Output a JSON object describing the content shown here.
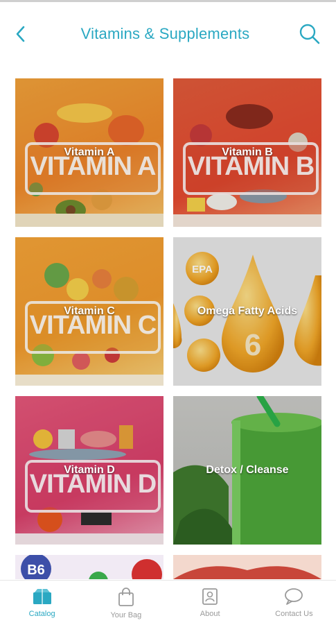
{
  "header": {
    "title": "Vitamins & Supplements"
  },
  "tiles": [
    {
      "label": "Vitamin A",
      "banner": "VITAMIN A"
    },
    {
      "label": "Vitamin B",
      "banner": "VITAMIN B"
    },
    {
      "label": "Vitamin C",
      "banner": "VITAMIN C"
    },
    {
      "label": "Omega Fatty Acids",
      "banner_text": "EPA",
      "big_number": "6"
    },
    {
      "label": "Vitamin D",
      "banner": "VITAMIN D"
    },
    {
      "label": "Detox / Cleanse"
    }
  ],
  "partial_tiles": [
    {
      "badge": "B6"
    }
  ],
  "bottom_nav": [
    {
      "label": "Catalog",
      "icon": "catalog-icon",
      "active": true
    },
    {
      "label": "Your Bag",
      "icon": "bag-icon",
      "active": false
    },
    {
      "label": "About",
      "icon": "about-icon",
      "active": false
    },
    {
      "label": "Contact Us",
      "icon": "chat-icon",
      "active": false
    }
  ],
  "colors": {
    "accent": "#2aa8c2",
    "nav_inactive": "#9a9a9a"
  }
}
